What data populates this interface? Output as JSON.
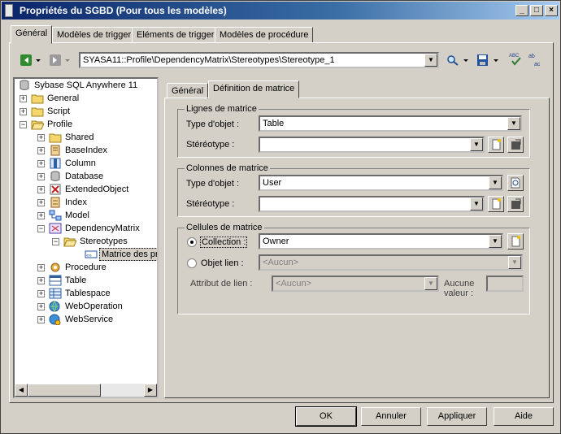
{
  "window": {
    "title": "Propriétés du SGBD (Pour tous les modèles)",
    "controls": {
      "minimize": "_",
      "maximize": "□",
      "close": "×"
    }
  },
  "tabs": [
    "Général",
    "Modèles de trigger",
    "Eléments de trigger",
    "Modèles de procédure"
  ],
  "toolbar": {
    "path": "SYASA11::Profile\\DependencyMatrix\\Stereotypes\\Stereotype_1",
    "icons": [
      "back-arrow-icon",
      "forward-arrow-icon",
      "find-icon",
      "save-icon",
      "spell-check-icon",
      "sort-icon"
    ]
  },
  "tree": {
    "root": "Sybase SQL Anywhere 11",
    "items": [
      {
        "label": "General",
        "icon": "folder",
        "level": 1,
        "expander": "+"
      },
      {
        "label": "Script",
        "icon": "folder",
        "level": 1,
        "expander": "+"
      },
      {
        "label": "Profile",
        "icon": "folder-open",
        "level": 1,
        "expander": "−"
      },
      {
        "label": "Shared",
        "icon": "folder",
        "level": 2,
        "expander": "+"
      },
      {
        "label": "BaseIndex",
        "icon": "baseindex",
        "level": 2,
        "expander": "+"
      },
      {
        "label": "Column",
        "icon": "column",
        "level": 2,
        "expander": "+"
      },
      {
        "label": "Database",
        "icon": "database",
        "level": 2,
        "expander": "+"
      },
      {
        "label": "ExtendedObject",
        "icon": "extended-object",
        "level": 2,
        "expander": "+"
      },
      {
        "label": "Index",
        "icon": "index",
        "level": 2,
        "expander": "+"
      },
      {
        "label": "Model",
        "icon": "model",
        "level": 2,
        "expander": "+"
      },
      {
        "label": "DependencyMatrix",
        "icon": "dependency-matrix",
        "level": 2,
        "expander": "−"
      },
      {
        "label": "Stereotypes",
        "icon": "folder-open",
        "level": 3,
        "expander": "−"
      },
      {
        "label": "Matrice des prop",
        "icon": "stereotype",
        "level": 4,
        "expander": "",
        "selected": true
      },
      {
        "label": "Procedure",
        "icon": "procedure",
        "level": 2,
        "expander": "+"
      },
      {
        "label": "Table",
        "icon": "table",
        "level": 2,
        "expander": "+"
      },
      {
        "label": "Tablespace",
        "icon": "tablespace",
        "level": 2,
        "expander": "+"
      },
      {
        "label": "WebOperation",
        "icon": "weboperation",
        "level": 2,
        "expander": "+"
      },
      {
        "label": "WebService",
        "icon": "webservice",
        "level": 2,
        "expander": "+"
      }
    ]
  },
  "subtabs": [
    "Général",
    "Définition de matrice"
  ],
  "rows_group": {
    "legend": "Lignes de matrice",
    "type_label": "Type d'objet :",
    "type_value": "Table",
    "stereo_label": "Stéréotype :",
    "stereo_value": ""
  },
  "cols_group": {
    "legend": "Colonnes de matrice",
    "type_label": "Type d'objet :",
    "type_value": "User",
    "stereo_label": "Stéréotype :",
    "stereo_value": ""
  },
  "cells_group": {
    "legend": "Cellules de matrice",
    "collection_label": "Collection :",
    "collection_value": "Owner",
    "link_label": "Objet lien :",
    "link_value": "<Aucun>",
    "attr_label": "Attribut de lien :",
    "attr_value": "<Aucun>",
    "noval_label_1": "Aucune",
    "noval_label_2": "valeur :"
  },
  "buttons": {
    "ok": "OK",
    "cancel": "Annuler",
    "apply": "Appliquer",
    "help": "Aide"
  }
}
